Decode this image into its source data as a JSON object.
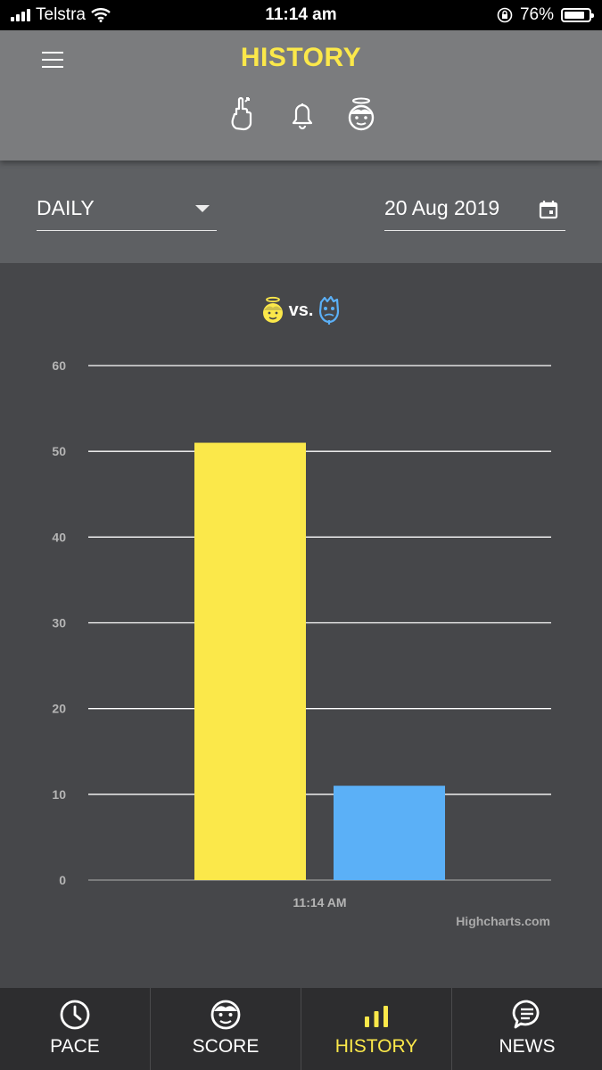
{
  "status_bar": {
    "carrier": "Telstra",
    "time": "11:14 am",
    "battery": "76%"
  },
  "header": {
    "title": "HISTORY",
    "icons": [
      "finger-icon",
      "bell-icon",
      "angel-face-icon"
    ]
  },
  "controls": {
    "period_value": "DAILY",
    "date_value": "20 Aug 2019"
  },
  "legend": {
    "vs_label": "vs."
  },
  "chart_data": {
    "type": "bar",
    "categories": [
      "11:14 AM"
    ],
    "series": [
      {
        "values": [
          51
        ],
        "color": "#fbe84a"
      },
      {
        "values": [
          11
        ],
        "color": "#5bb0f7"
      }
    ],
    "ylim": [
      0,
      60
    ],
    "yticks": [
      0,
      10,
      20,
      30,
      40,
      50,
      60
    ],
    "grid": true,
    "credits": "Highcharts.com"
  },
  "colors": {
    "accent": "#fbe84a",
    "blue": "#5bb0f7",
    "header_bg": "#7b7c7e",
    "controls_bg": "#5e6063",
    "chart_bg": "#46474a",
    "tabbar_bg": "#2d2d2f"
  },
  "tabs": [
    {
      "label": "PACE",
      "icon": "clock-icon"
    },
    {
      "label": "SCORE",
      "icon": "face-icon"
    },
    {
      "label": "HISTORY",
      "icon": "bar-chart-icon",
      "active": true
    },
    {
      "label": "NEWS",
      "icon": "chat-icon"
    }
  ]
}
